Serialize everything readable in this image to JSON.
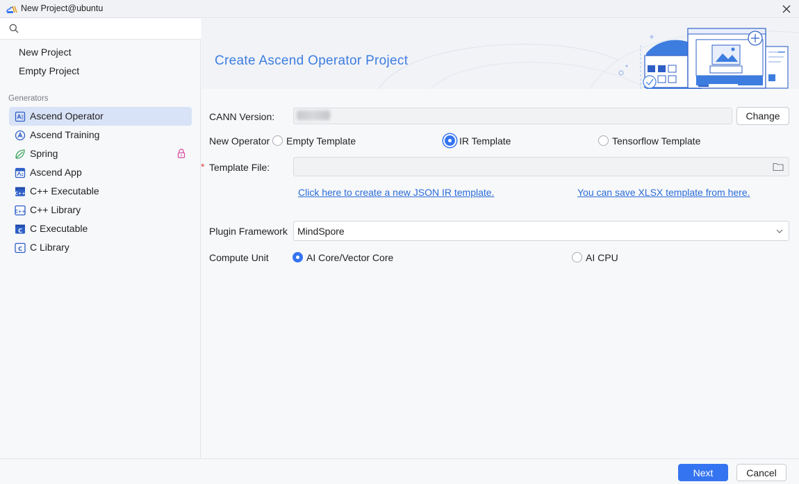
{
  "window": {
    "title": "New Project@ubuntu"
  },
  "search": {
    "placeholder": "",
    "value": ""
  },
  "left": {
    "top_items": [
      "New Project",
      "Empty Project"
    ],
    "section_label": "Generators",
    "generators": [
      {
        "label": "Ascend Operator",
        "icon": "ascend-operator-icon",
        "selected": true
      },
      {
        "label": "Ascend Training",
        "icon": "ascend-training-icon"
      },
      {
        "label": "Spring",
        "icon": "spring-leaf-icon",
        "locked": true
      },
      {
        "label": "Ascend App",
        "icon": "ascend-app-icon"
      },
      {
        "label": "C++ Executable",
        "icon": "cpp-executable-icon"
      },
      {
        "label": "C++ Library",
        "icon": "cpp-library-icon"
      },
      {
        "label": "C Executable",
        "icon": "c-executable-icon"
      },
      {
        "label": "C Library",
        "icon": "c-library-icon"
      }
    ]
  },
  "banner": {
    "title": "Create Ascend Operator Project"
  },
  "form": {
    "cann_label": "CANN Version:",
    "change_label": "Change",
    "new_operator_label": "New Operator",
    "templates": [
      "Empty Template",
      "IR Template",
      "Tensorflow Template"
    ],
    "selected_template": "IR Template",
    "template_file_label": "Template File:",
    "required_marker": "*",
    "template_file_value": "",
    "link_json": "Click here to create a new JSON IR template.",
    "link_xlsx": "You can save XLSX template from here.",
    "plugin_label": "Plugin Framework",
    "plugin_value": "MindSpore",
    "compute_label": "Compute Unit",
    "compute_options": [
      "AI Core/Vector Core",
      "AI CPU"
    ],
    "selected_compute": "AI Core/Vector Core"
  },
  "footer": {
    "next_label": "Next",
    "cancel_label": "Cancel"
  },
  "colors": {
    "accent": "#3574f0",
    "title_blue": "#3d7de0",
    "link": "#2a6bd8",
    "lock_pink": "#d9479e"
  }
}
